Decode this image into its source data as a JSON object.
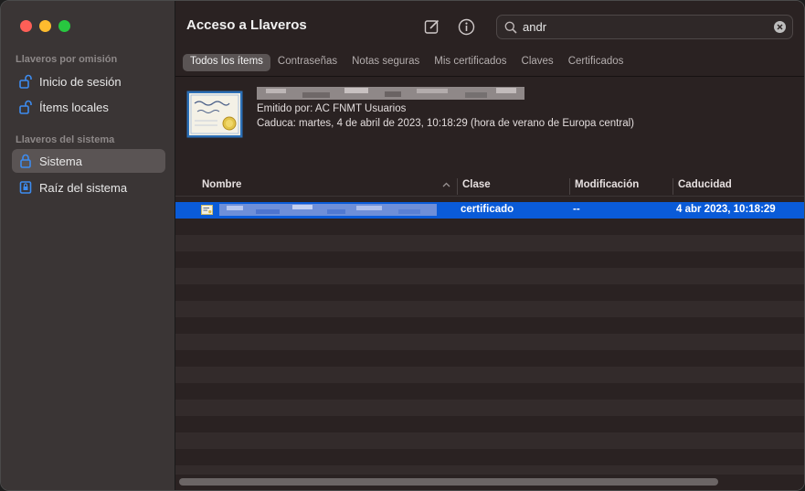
{
  "sidebar": {
    "sections": [
      {
        "title": "Llaveros por omisión",
        "items": [
          {
            "label": "Inicio de sesión",
            "icon": "unlocked-lock-icon"
          },
          {
            "label": "Ítems locales",
            "icon": "unlocked-lock-icon"
          }
        ]
      },
      {
        "title": "Llaveros del sistema",
        "items": [
          {
            "label": "Sistema",
            "icon": "lock-icon",
            "selected": true
          },
          {
            "label": "Raíz del sistema",
            "icon": "keychain-folder-icon"
          }
        ]
      }
    ]
  },
  "toolbar": {
    "title": "Acceso a Llaveros",
    "compose_icon": "compose-icon",
    "info_icon": "info-icon",
    "search": {
      "value": "andr",
      "placeholder": "Buscar"
    }
  },
  "tabs": [
    {
      "label": "Todos los ítems",
      "active": true
    },
    {
      "label": "Contraseñas"
    },
    {
      "label": "Notas seguras"
    },
    {
      "label": "Mis certificados"
    },
    {
      "label": "Claves"
    },
    {
      "label": "Certificados"
    }
  ],
  "detail": {
    "issued_by": "Emitido por: AC FNMT Usuarios",
    "expires": "Caduca: martes, 4 de abril de 2023, 10:18:29 (hora de verano de Europa central)"
  },
  "table": {
    "columns": [
      "Nombre",
      "Clase",
      "Modificación",
      "Caducidad"
    ],
    "rows": [
      {
        "clase": "certificado",
        "modificacion": "--",
        "caducidad": "4 abr 2023, 10:18:29",
        "selected": true
      }
    ]
  },
  "colors": {
    "selection": "#0a5bd8",
    "sidebar_bg": "#3a3535",
    "main_bg": "#2a2222"
  }
}
